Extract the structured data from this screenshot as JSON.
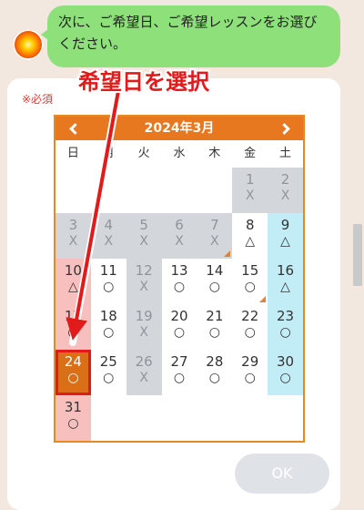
{
  "chat": {
    "message": "次に、ご希望日、ご希望レッスンをお選びください。",
    "avatar_icon": "sun-avatar-icon"
  },
  "form": {
    "required_label": "※必須",
    "ok_label": "OK"
  },
  "calendar": {
    "title": "2024年3月",
    "prev_icon": "chevron-left-icon",
    "next_icon": "chevron-right-icon",
    "weekdays": [
      "日",
      "月",
      "火",
      "水",
      "木",
      "金",
      "土"
    ],
    "selected_day": 24,
    "days": [
      {
        "day": "1",
        "mark": "X",
        "status": "unavailable"
      },
      {
        "day": "2",
        "mark": "X",
        "status": "unavailable"
      },
      {
        "day": "3",
        "mark": "X",
        "status": "unavailable"
      },
      {
        "day": "4",
        "mark": "X",
        "status": "unavailable"
      },
      {
        "day": "5",
        "mark": "X",
        "status": "unavailable"
      },
      {
        "day": "6",
        "mark": "X",
        "status": "unavailable"
      },
      {
        "day": "7",
        "mark": "X",
        "status": "unavailable"
      },
      {
        "day": "8",
        "mark": "△",
        "status": "few"
      },
      {
        "day": "9",
        "mark": "△",
        "status": "few"
      },
      {
        "day": "10",
        "mark": "△",
        "status": "few"
      },
      {
        "day": "11",
        "mark": "○",
        "status": "available"
      },
      {
        "day": "12",
        "mark": "X",
        "status": "unavailable"
      },
      {
        "day": "13",
        "mark": "○",
        "status": "available"
      },
      {
        "day": "14",
        "mark": "○",
        "status": "available"
      },
      {
        "day": "15",
        "mark": "○",
        "status": "available"
      },
      {
        "day": "16",
        "mark": "△",
        "status": "few"
      },
      {
        "day": "17",
        "mark": "○",
        "status": "available"
      },
      {
        "day": "18",
        "mark": "○",
        "status": "available"
      },
      {
        "day": "19",
        "mark": "X",
        "status": "unavailable"
      },
      {
        "day": "20",
        "mark": "○",
        "status": "available"
      },
      {
        "day": "21",
        "mark": "○",
        "status": "available"
      },
      {
        "day": "22",
        "mark": "○",
        "status": "available"
      },
      {
        "day": "23",
        "mark": "○",
        "status": "available"
      },
      {
        "day": "24",
        "mark": "○",
        "status": "available"
      },
      {
        "day": "25",
        "mark": "○",
        "status": "available"
      },
      {
        "day": "26",
        "mark": "X",
        "status": "unavailable"
      },
      {
        "day": "27",
        "mark": "○",
        "status": "available"
      },
      {
        "day": "28",
        "mark": "○",
        "status": "available"
      },
      {
        "day": "29",
        "mark": "○",
        "status": "available"
      },
      {
        "day": "30",
        "mark": "○",
        "status": "available"
      },
      {
        "day": "31",
        "mark": "○",
        "status": "available"
      }
    ]
  },
  "annotation": {
    "label": "希望日を選択",
    "color": "#e11b1b"
  },
  "colors": {
    "accent": "#e8781f",
    "chat_bubble": "#8de07a",
    "sunday": "#f7c0bf",
    "saturday": "#c2ecf6",
    "unavailable": "#d3d7dc"
  }
}
